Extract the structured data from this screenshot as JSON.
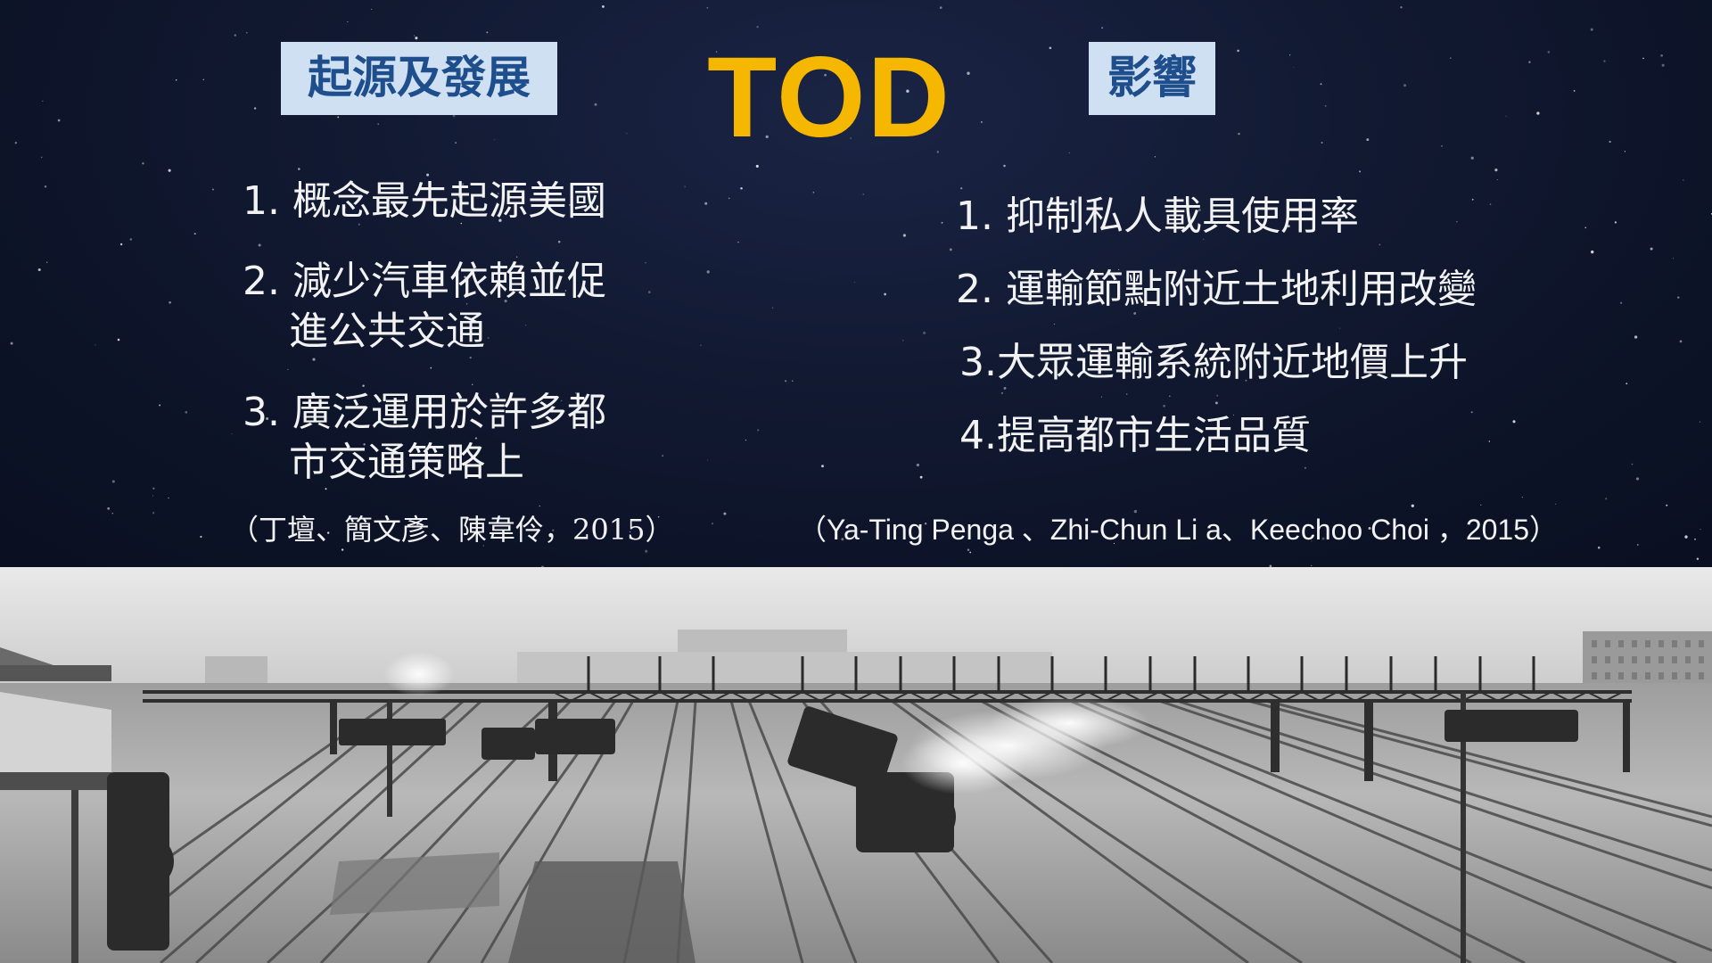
{
  "title": "TOD",
  "origin": {
    "label": "起源及發展",
    "items": [
      {
        "num": "1.",
        "text": "概念最先起源美國",
        "cont": ""
      },
      {
        "num": "2.",
        "text": "減少汽車依賴並促",
        "cont": "進公共交通"
      },
      {
        "num": "3.",
        "text": "廣泛運用於許多都",
        "cont": "市交通策略上"
      }
    ],
    "citation": "（丁壇、簡文彥、陳韋伶，2015）"
  },
  "impact": {
    "label": "影響",
    "items": [
      {
        "num": "1.",
        "text": "抑制私人載具使用率"
      },
      {
        "num": "2.",
        "text": "運輸節點附近土地利用改變"
      },
      {
        "num": "3.",
        "text": "大眾運輸系統附近地價上升"
      },
      {
        "num": "4.",
        "text": "提高都市生活品質"
      }
    ],
    "citation": "（Ya-Ting Penga 、Zhi-Chun Li a、Keechoo Choi ，2015）"
  },
  "colors": {
    "title": "#f5b700",
    "label_background": "#cfe0f2",
    "label_text": "#1f4e8c",
    "body_text": "#f2f2f2",
    "sky": "#0c1327"
  }
}
